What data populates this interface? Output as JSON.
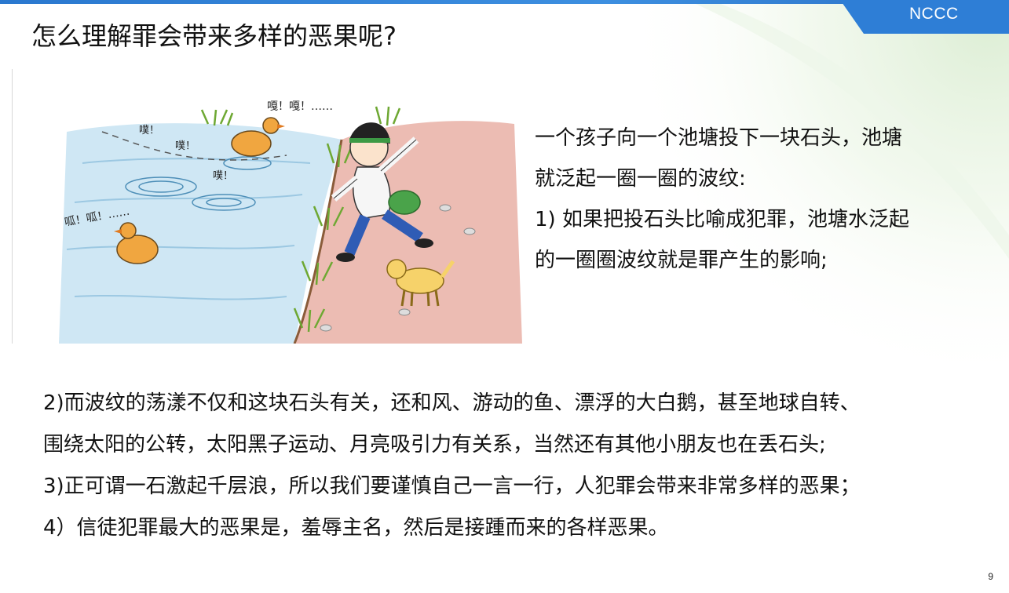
{
  "brand": "NCCC",
  "title": "怎么理解罪会带来多样的恶果呢?",
  "illustration": {
    "caption_duck_top": "嘎！嘎！……",
    "caption_duck_left": "呱！呱！……",
    "splash_1": "噗！",
    "splash_2": "噗！",
    "splash_3": "噗！"
  },
  "right_paragraph": {
    "line1": "一个孩子向一个池塘投下一块石头，池塘",
    "line2": "就泛起一圈一圈的波纹:",
    "line3": "1) 如果把投石头比喻成犯罪，池塘水泛起",
    "line4": "的一圈圈波纹就是罪产生的影响;"
  },
  "bottom_paragraph": {
    "line1": "2)而波纹的荡漾不仅和这块石头有关，还和风、游动的鱼、漂浮的大白鹅，甚至地球自转、",
    "line2": "围绕太阳的公转，太阳黑子运动、月亮吸引力有关系，当然还有其他小朋友也在丢石头;",
    "line3": "3)正可谓一石激起千层浪，所以我们要谨慎自己一言一行，人犯罪会带来非常多样的恶果；",
    "line4": "4）信徒犯罪最大的恶果是，羞辱主名，然后是接踵而来的各样恶果。"
  },
  "page_number": "9",
  "colors": {
    "accent_blue": "#2a78cf",
    "water": "#bfe0f2",
    "bank": "#e6a9a0",
    "grass": "#7bb33a",
    "duck": "#f0a640"
  }
}
